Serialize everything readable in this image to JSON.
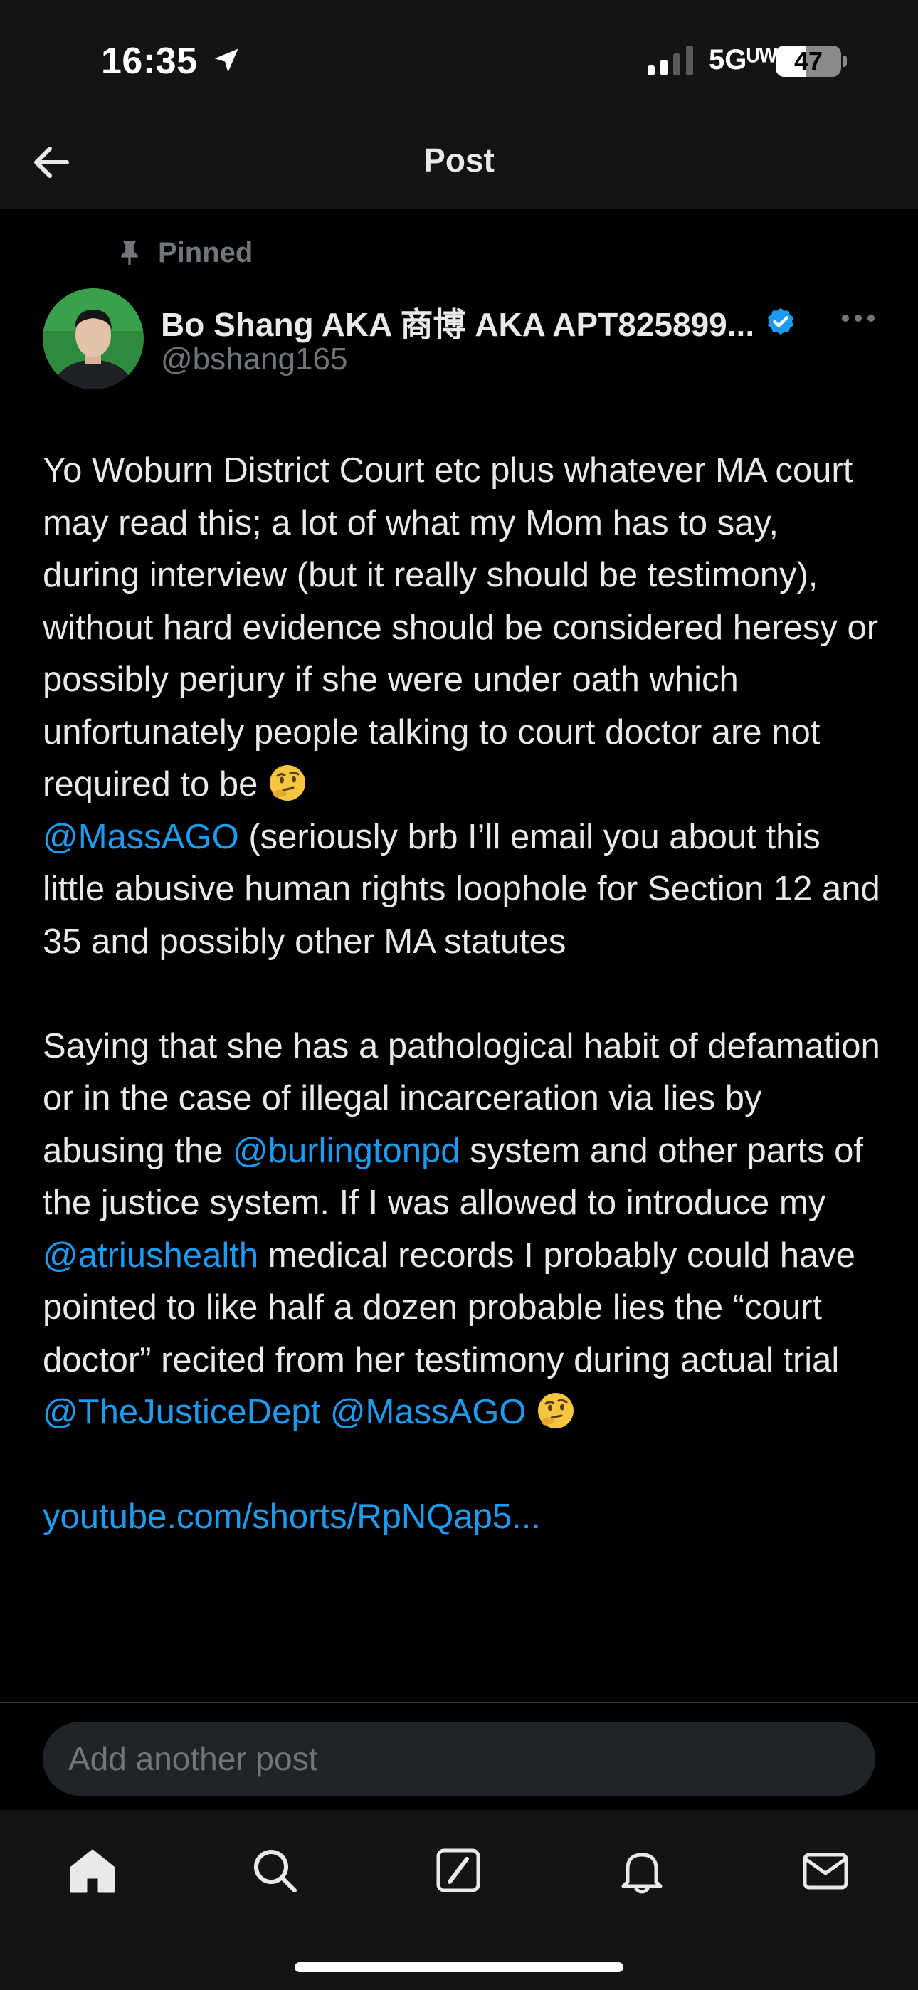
{
  "status_bar": {
    "time": "16:35",
    "network": "5Gᵁᵂ",
    "battery_percent": "47",
    "battery_level": 0.47
  },
  "header": {
    "title": "Post"
  },
  "post": {
    "pinned_label": "Pinned",
    "author_name": "Bo Shang AKA 商博 AKA APT825899...",
    "author_handle": "@bshang165",
    "verified": true,
    "body": {
      "p1_text1": "Yo Woburn District Court etc plus whatever MA court may read this; a lot of what my Mom has to say, during interview (but it really should be testimony), without hard evidence should be considered heresy or possibly perjury if she were under oath which unfortunately people talking to court doctor are not required to be ",
      "p1_mention1": "@MassAGO",
      "p1_text2": " (seriously brb I’ll email you about this little abusive human rights loophole for Section 12 and 35 and possibly other MA statutes",
      "p2_text1": "Saying that she has a pathological habit of defamation or in the case of illegal incarceration via lies by abusing the ",
      "p2_mention1": "@burlingtonpd",
      "p2_text2": " system and other parts of the justice system. If I was allowed to introduce my ",
      "p2_mention2": "@atriushealth",
      "p2_text3": " medical records I probably could have pointed to like half a dozen probable lies the “court doctor” recited from her testimony during actual trial ",
      "p2_mention3": "@TheJusticeDept",
      "p2_text4": " ",
      "p2_mention4": "@MassAGO",
      "p2_text5": " ",
      "link": "youtube.com/shorts/RpNQap5..."
    }
  },
  "reply": {
    "placeholder": "Add another post"
  },
  "colors": {
    "background": "#000000",
    "header_bg": "#141414",
    "text": "#e7e9ea",
    "secondary_text": "#71767b",
    "accent": "#1d9bf0"
  },
  "icons": {
    "back": "arrow-left-icon",
    "pin": "pin-icon",
    "verified": "verified-badge-icon",
    "more": "more-horizontal-icon",
    "emoji": "thinking-face-emoji",
    "tabs": [
      "home-icon",
      "search-icon",
      "grok-icon",
      "notifications-icon",
      "messages-icon"
    ]
  }
}
